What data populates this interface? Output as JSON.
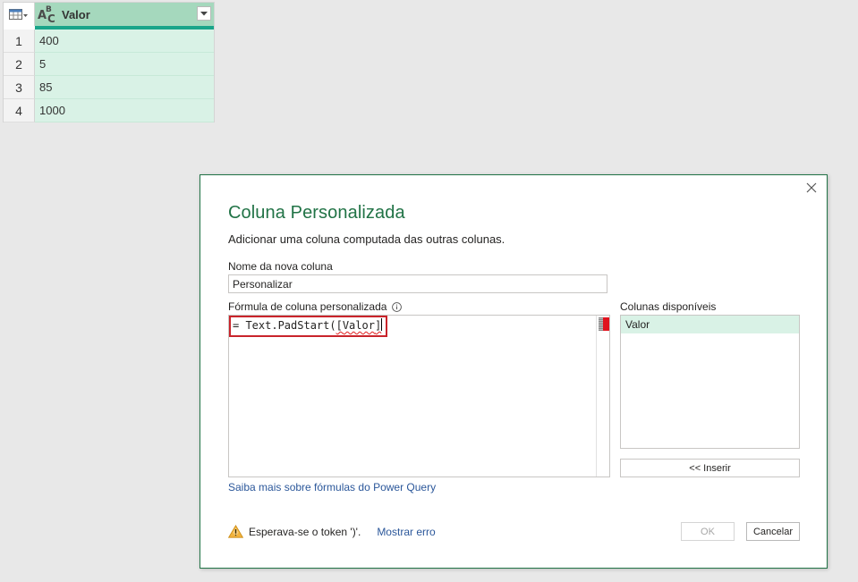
{
  "grid": {
    "column": {
      "name": "Valor",
      "type_icon": "abc-text-type-icon"
    },
    "rows": [
      {
        "num": "1",
        "value": "400"
      },
      {
        "num": "2",
        "value": "5"
      },
      {
        "num": "3",
        "value": "85"
      },
      {
        "num": "4",
        "value": "1000"
      }
    ]
  },
  "dialog": {
    "title": "Coluna Personalizada",
    "description": "Adicionar uma coluna computada das outras colunas.",
    "name_label": "Nome da nova coluna",
    "name_value": "Personalizar",
    "formula_label": "Fórmula de coluna personalizada",
    "formula": {
      "prefix": "= Text.PadStart(",
      "open_bracket": "[",
      "field": "Valor",
      "close_bracket": "]"
    },
    "columns_label": "Colunas disponíveis",
    "columns": [
      "Valor"
    ],
    "insert_label": "<< Inserir",
    "learn_link": "Saiba mais sobre fórmulas do Power Query",
    "error_message": "Esperava-se o token ')'.",
    "show_error_label": "Mostrar erro",
    "ok_label": "OK",
    "cancel_label": "Cancelar"
  },
  "colors": {
    "accent": "#217346",
    "header_green": "#a5d8bd",
    "row_green": "#d9f2e6",
    "highlight_red": "#c9242b",
    "link_blue": "#2b579a"
  }
}
